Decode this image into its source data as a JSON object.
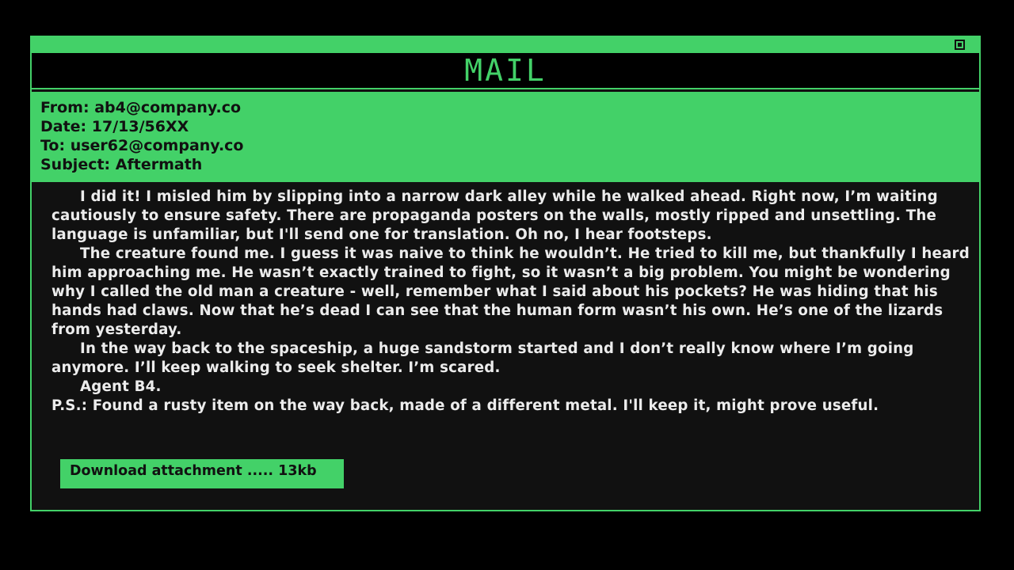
{
  "window": {
    "title": "MAIL",
    "accent_color": "#43d168",
    "close_icon": "square-close-icon"
  },
  "headers": {
    "from": "From: ab4@company.co",
    "date": "Date: 17/13/56XX",
    "to": "To: user62@company.co",
    "subject": "Subject: Aftermath"
  },
  "body": {
    "paragraphs": [
      "I did it! I misled him by slipping into a narrow dark alley while he walked ahead. Right now, I’m waiting cautiously to ensure safety. There are propaganda posters on the walls, mostly ripped and unsettling. The language is unfamiliar, but I'll send one for translation. Oh no, I hear footsteps.",
      "The creature found me. I guess it was naive to think he wouldn’t. He tried to kill me, but thankfully I heard him approaching me. He wasn’t exactly trained to fight, so it wasn’t a big problem. You might be wondering why I called the old man a creature - well, remember what I said about his pockets? He was hiding that his hands had claws. Now that he’s dead I can see that the human form wasn’t his own. He’s one of the lizards from yesterday.",
      "In the way back to the spaceship, a huge sandstorm started and I don’t really know where I’m going anymore. I’ll keep walking to seek shelter. I’m scared.",
      "Agent B4.",
      "P.S.: Found a rusty item on the way back, made of a different metal. I'll keep it, might prove useful."
    ]
  },
  "attachment": {
    "label": "Download attachment ..... 13kb"
  }
}
